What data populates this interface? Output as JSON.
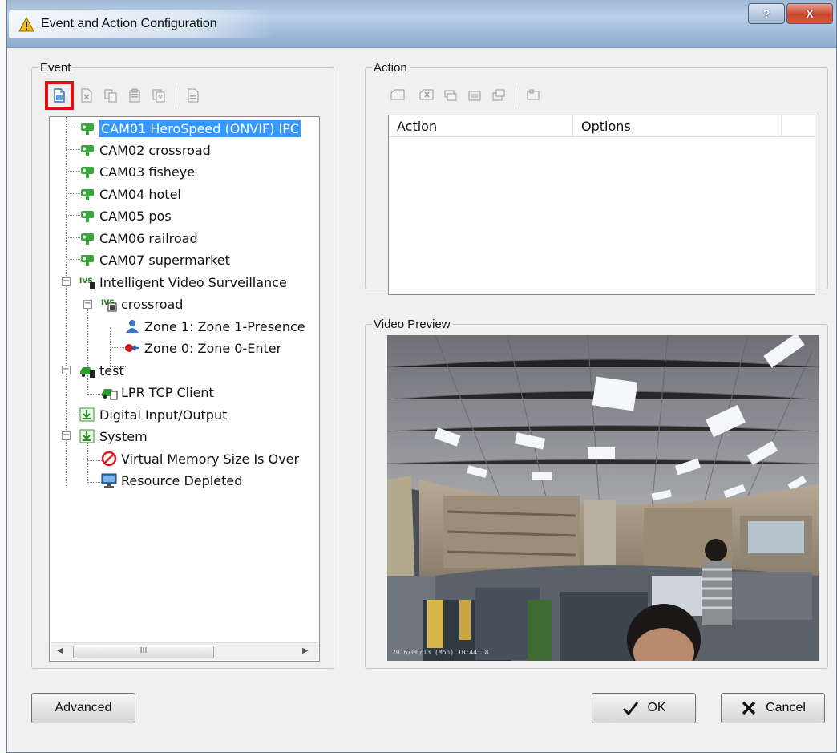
{
  "window": {
    "title": "Event and Action Configuration",
    "help_label": "?",
    "close_label": "X"
  },
  "event_group": {
    "legend": "Event",
    "toolbar_icons": [
      "new-icon",
      "delete-icon",
      "copy-icon",
      "paste-icon",
      "duplicate-icon",
      "properties-icon"
    ],
    "tree": [
      {
        "label": "CAM01 HeroSpeed (ONVIF) IPC",
        "icon": "camera-icon",
        "selected": true
      },
      {
        "label": "CAM02 crossroad",
        "icon": "camera-icon"
      },
      {
        "label": "CAM03 fisheye",
        "icon": "camera-icon"
      },
      {
        "label": "CAM04 hotel",
        "icon": "camera-icon"
      },
      {
        "label": "CAM05 pos",
        "icon": "camera-icon"
      },
      {
        "label": "CAM06 railroad",
        "icon": "camera-icon"
      },
      {
        "label": "CAM07 supermarket",
        "icon": "camera-icon"
      },
      {
        "label": "Intelligent Video Surveillance",
        "icon": "ivs-icon",
        "ivs_label": "IVS"
      },
      {
        "label": "crossroad",
        "icon": "ivs-icon",
        "ivs_label": "IVS"
      },
      {
        "label": "Zone 1: Zone 1-Presence",
        "icon": "person-icon"
      },
      {
        "label": "Zone 0: Zone 0-Enter",
        "icon": "enter-arrow-icon"
      },
      {
        "label": "test",
        "icon": "car-icon"
      },
      {
        "label": "LPR TCP Client",
        "icon": "car-icon"
      },
      {
        "label": "Digital Input/Output",
        "icon": "digital-io-icon"
      },
      {
        "label": "System",
        "icon": "digital-io-icon"
      },
      {
        "label": "Virtual Memory Size Is Over",
        "icon": "prohibited-icon"
      },
      {
        "label": "Resource Depleted",
        "icon": "monitor-icon"
      }
    ],
    "scrollbar_grip": "III"
  },
  "action_group": {
    "legend": "Action",
    "toolbar_icons": [
      "new-icon",
      "delete-icon",
      "copy-icon",
      "paste-icon",
      "duplicate-icon",
      "properties-icon"
    ],
    "columns": [
      "Action",
      "Options"
    ]
  },
  "preview_group": {
    "legend": "Video Preview",
    "timestamp": "2016/06/13 (Mon) 10:44:18"
  },
  "buttons": {
    "advanced": "Advanced",
    "ok": "OK",
    "cancel": "Cancel"
  },
  "colors": {
    "selection": "#3399ff",
    "highlight_box": "#dd1111",
    "camera_green": "#3aa83a"
  }
}
